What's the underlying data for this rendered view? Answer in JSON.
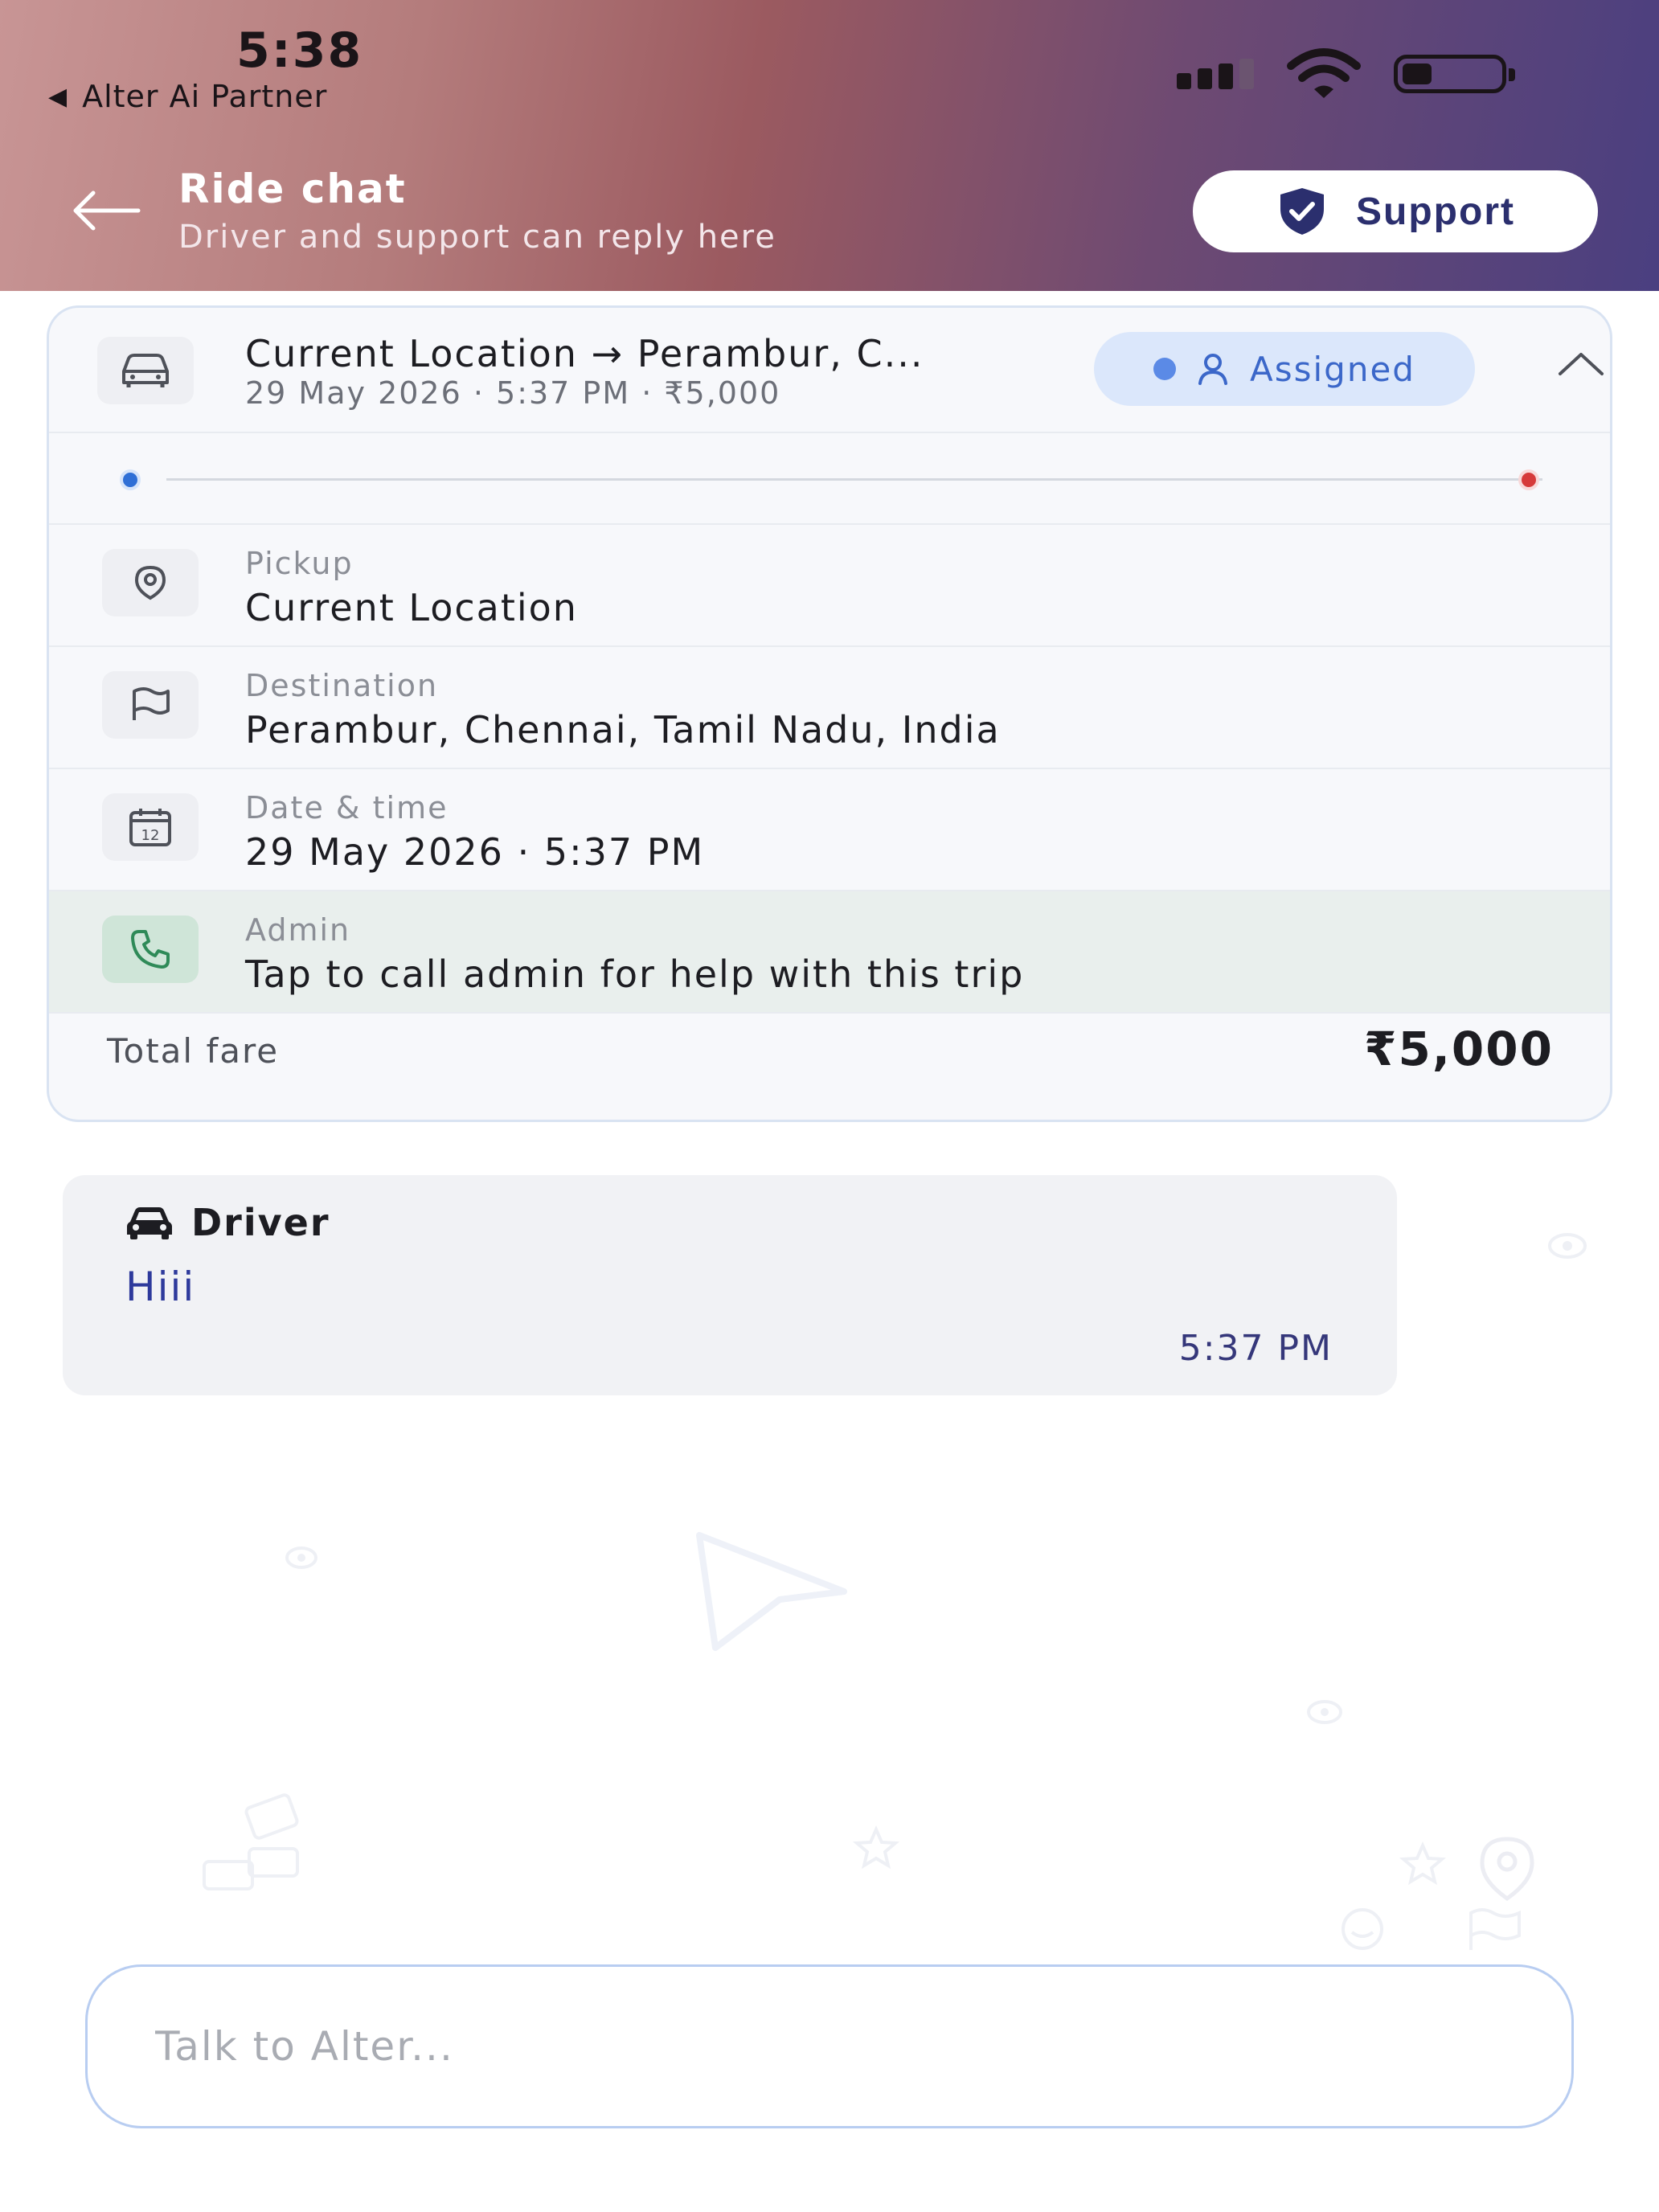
{
  "status_bar": {
    "time": "5:38",
    "back_app": "Alter Ai Partner",
    "icons": [
      "cellular-signal-icon",
      "wifi-icon",
      "battery-icon"
    ]
  },
  "header": {
    "title": "Ride chat",
    "subtitle": "Driver and support can reply here",
    "support_label": "Support"
  },
  "trip_card": {
    "route": "Current Location → Perambur, C...",
    "meta": "29 May 2026 · 5:37 PM · ₹5,000",
    "status": "Assigned",
    "rows": [
      {
        "label": "Pickup",
        "value": "Current Location",
        "icon": "location-pin-icon"
      },
      {
        "label": "Destination",
        "value": "Perambur, Chennai, Tamil Nadu, India",
        "icon": "flag-icon"
      },
      {
        "label": "Date & time",
        "value": "29 May 2026 · 5:37 PM",
        "icon": "calendar-icon",
        "icon_text": "12"
      },
      {
        "label": "Admin",
        "value": "Tap to call admin for help with this trip",
        "icon": "phone-icon"
      }
    ],
    "total_label": "Total fare",
    "total_value": "₹5,000"
  },
  "messages": [
    {
      "sender": "Driver",
      "text": "Hiii",
      "time": "5:37 PM"
    }
  ],
  "composer": {
    "placeholder": "Talk to Alter..."
  },
  "colors": {
    "header_gradient_start": "#c89595",
    "header_gradient_end": "#4a3f80",
    "assigned_bg": "#dbe7fb",
    "assigned_text": "#3b67c9",
    "admin_row_bg": "#e9efed",
    "message_text": "#2e3a9c"
  }
}
